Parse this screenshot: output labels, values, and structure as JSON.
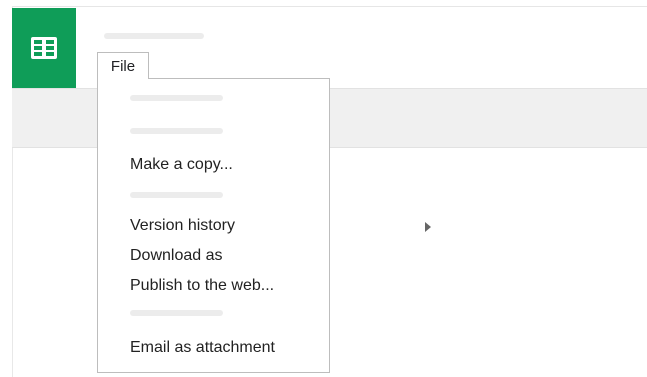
{
  "menu": {
    "file_label": "File",
    "items": {
      "make_copy": "Make a copy...",
      "version_history": "Version history",
      "download_as": "Download as",
      "publish_web": "Publish to the web...",
      "email_attachment": "Email as attachment"
    }
  },
  "colors": {
    "brand": "#0f9d58"
  },
  "icons": {
    "logo": "sheets-grid-icon",
    "submenu": "submenu-arrow-icon"
  }
}
